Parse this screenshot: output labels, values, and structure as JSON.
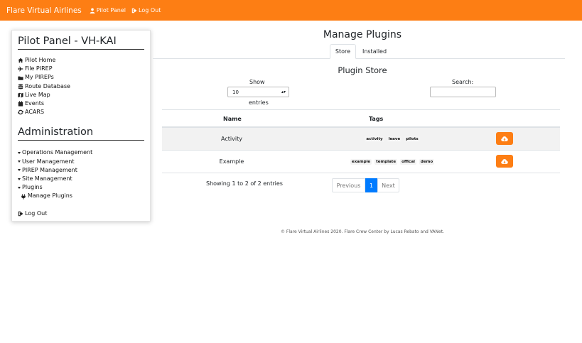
{
  "navbar": {
    "brand": "Flare Virtual Airlines",
    "links": [
      {
        "label": "Pilot Panel",
        "icon": "user-icon"
      },
      {
        "label": "Log Out",
        "icon": "sign-out-icon"
      }
    ]
  },
  "sidebar": {
    "title": "Pilot Panel - VH-KAI",
    "pilot_items": [
      {
        "label": "Pilot Home",
        "icon": "home-icon"
      },
      {
        "label": "File PIREP",
        "icon": "plane-icon"
      },
      {
        "label": "My PIREPs",
        "icon": "folder-icon"
      },
      {
        "label": "Route Database",
        "icon": "database-icon"
      },
      {
        "label": "Live Map",
        "icon": "map-icon"
      },
      {
        "label": "Events",
        "icon": "calendar-icon"
      },
      {
        "label": "ACARS",
        "icon": "sync-icon"
      }
    ],
    "admin_title": "Administration",
    "admin_items": [
      {
        "label": "Operations Management"
      },
      {
        "label": "User Management"
      },
      {
        "label": "PIREP Management"
      },
      {
        "label": "Site Management"
      },
      {
        "label": "Plugins"
      }
    ],
    "plugins_sub": {
      "label": "Manage Plugins",
      "icon": "plug-icon"
    },
    "logout": {
      "label": "Log Out",
      "icon": "sign-out-icon"
    }
  },
  "main": {
    "title": "Manage Plugins",
    "tabs": [
      {
        "label": "Store",
        "active": true
      },
      {
        "label": "Installed",
        "active": false
      }
    ],
    "store_title": "Plugin Store",
    "length": {
      "show_label": "Show",
      "value": "10",
      "entries_label": "entries"
    },
    "search": {
      "label": "Search:",
      "value": ""
    },
    "table": {
      "headers": [
        "Name",
        "Tags"
      ],
      "rows": [
        {
          "name": "Activity",
          "tags": [
            "activity",
            "leave",
            "pilots"
          ]
        },
        {
          "name": "Example",
          "tags": [
            "example",
            "template",
            "offical",
            "demo"
          ]
        }
      ]
    },
    "info": "Showing 1 to 2 of 2 entries",
    "pagination": {
      "prev": "Previous",
      "current": "1",
      "next": "Next"
    },
    "footer": "© Flare Virtual Airlines 2020. Flare Crew Center by Lucas Rebato and VANet."
  },
  "colors": {
    "accent": "#fd7e14",
    "page_active": "#007bff"
  }
}
